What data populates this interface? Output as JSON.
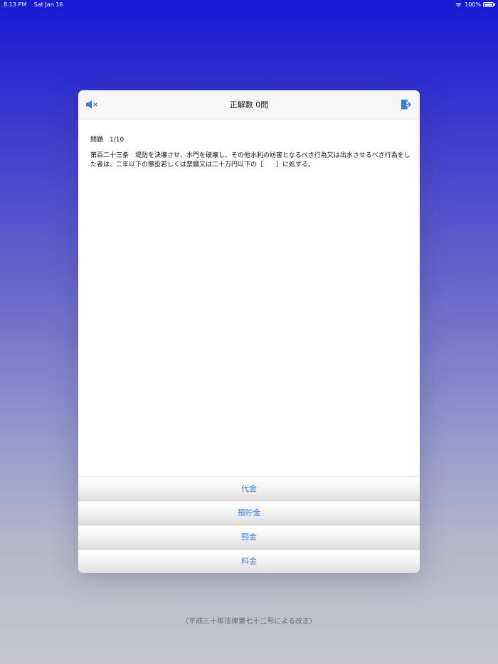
{
  "status_bar": {
    "time": "8:13 PM",
    "date": "Sat Jan 16",
    "battery": "100%"
  },
  "dialog": {
    "title": "正解数 0問",
    "question_number": "問題　1/10",
    "question_text": "第百二十三条　堤防を決壊させ、水門を破壊し、その他水利の妨害となるべき行為又は出水させるべき行為をした者は、二年以下の懲役若しくは禁錮又は二十万円以下の［　　］に処する。",
    "answers": [
      "代金",
      "預貯金",
      "罰金",
      "料金"
    ]
  },
  "footer": {
    "note": "（平成三十年法律第七十二号による改正）"
  },
  "colors": {
    "accent": "#2f7fe6",
    "background_top": "#1919d6",
    "background_bottom": "#c6c6cc"
  },
  "icons": {
    "mute": "speaker-mute-icon",
    "exit": "exit-icon",
    "wifi": "wifi-icon",
    "battery": "battery-icon"
  }
}
